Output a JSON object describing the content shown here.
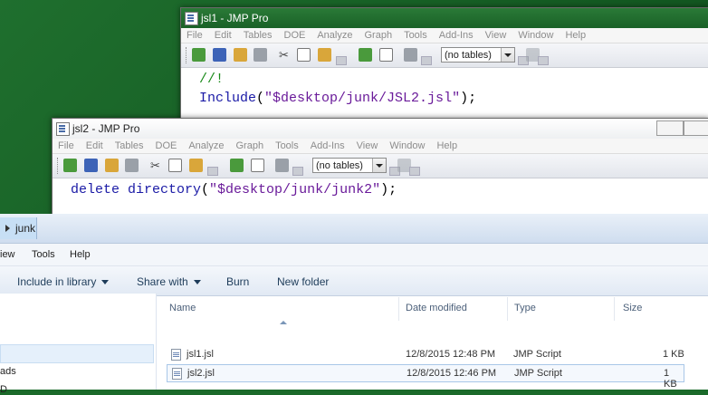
{
  "windows": {
    "jmp1": {
      "title": "jsl1 - JMP Pro",
      "code_line1": "//!",
      "code_fn": "Include",
      "code_arg": "\"$desktop/junk/JSL2.jsl\"",
      "code_end": ");"
    },
    "jmp2": {
      "title": "jsl2 - JMP Pro",
      "code_fn": "delete directory",
      "code_arg": "\"$desktop/junk/junk2\"",
      "code_end": ");"
    },
    "menu": [
      "File",
      "Edit",
      "Tables",
      "DOE",
      "Analyze",
      "Graph",
      "Tools",
      "Add-Ins",
      "View",
      "Window",
      "Help"
    ],
    "table_combo": "(no tables)"
  },
  "explorer": {
    "breadcrumb": "junk",
    "menu": [
      "View",
      "Tools",
      "Help"
    ],
    "menu_view_visible": "iew",
    "commands": {
      "include": "Include in library",
      "share": "Share with",
      "burn": "Burn",
      "new_folder": "New folder"
    },
    "nav_items": [
      "ads",
      "D"
    ],
    "columns": {
      "name": "Name",
      "date": "Date modified",
      "type": "Type",
      "size": "Size"
    },
    "files": [
      {
        "name": "jsl1.jsl",
        "date": "12/8/2015 12:48 PM",
        "type": "JMP Script",
        "size": "1 KB"
      },
      {
        "name": "jsl2.jsl",
        "date": "12/8/2015 12:46 PM",
        "type": "JMP Script",
        "size": "1 KB"
      }
    ]
  },
  "colors": {
    "desktop": "#1b6a2a",
    "jmp_title_active": "#1f6f2e",
    "string": "#6a1b9a",
    "function": "#1a1aa6"
  }
}
